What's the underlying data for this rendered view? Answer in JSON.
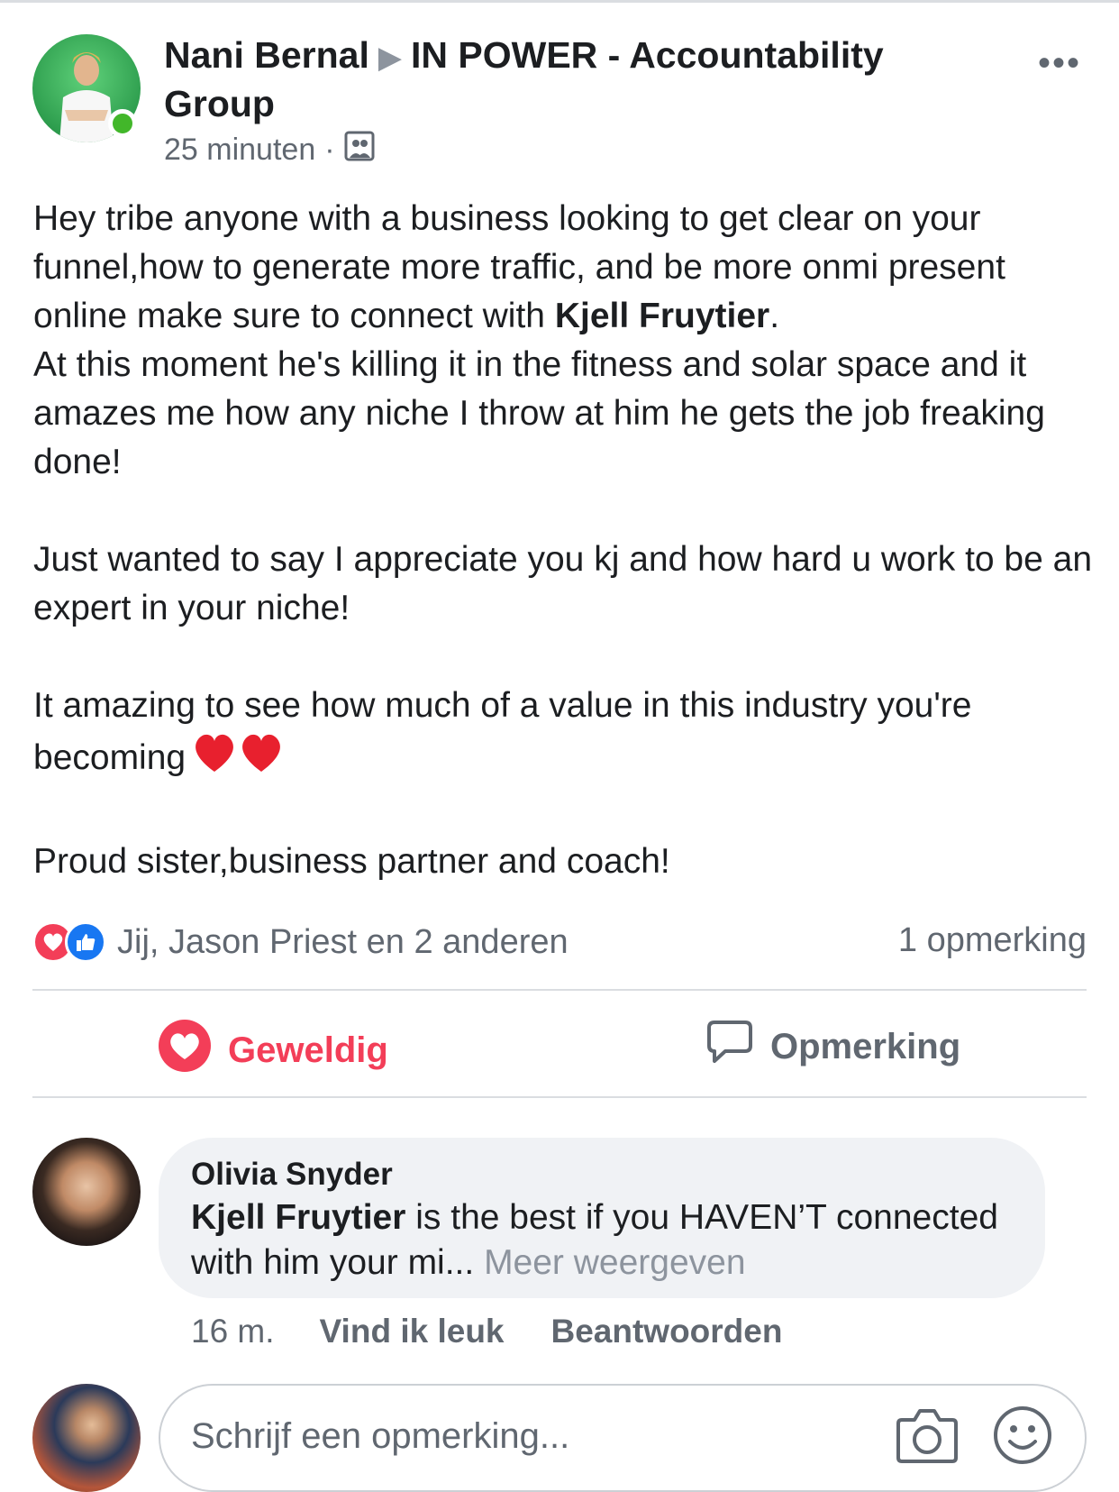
{
  "post": {
    "author": "Nani Bernal",
    "group": "IN POWER - Accountability Group",
    "time": "25 minuten",
    "more_label": "•••",
    "paragraphs": [
      {
        "before": "Hey tribe anyone with a business looking to get clear on your funnel,how to generate more traffic, and be more onmi present online make sure to connect with ",
        "bold": "Kjell Fruytier",
        "after": ".\nAt this moment he's killing it in the fitness and solar space and it amazes me how any niche I throw at him he gets the job freaking done!"
      },
      {
        "text": "Just wanted to say I appreciate you kj and how hard u work to be an expert in your niche!"
      },
      {
        "text": "It amazing to see how much of a value in this industry you're becoming"
      },
      {
        "text": "Proud sister,business partner and coach!"
      }
    ]
  },
  "reactions": {
    "summary": "Jij, Jason Priest en 2 anderen",
    "comments_count": "1 opmerking"
  },
  "actions": {
    "love": "Geweldig",
    "comment": "Opmerking"
  },
  "comment": {
    "author": "Olivia  Snyder",
    "mention": "Kjell Fruytier",
    "text": " is the best if you HAVEN’T connected with him your mi...",
    "more": " Meer weergeven",
    "time": "16 m.",
    "like": "Vind ik leuk",
    "reply": "Beantwoorden"
  },
  "composer": {
    "placeholder": "Schrijf een opmerking..."
  },
  "icons": {
    "group_icon": "group-icon",
    "love_color": "#f33e58",
    "like_color": "#1877f2",
    "online_color": "#42b72a"
  }
}
